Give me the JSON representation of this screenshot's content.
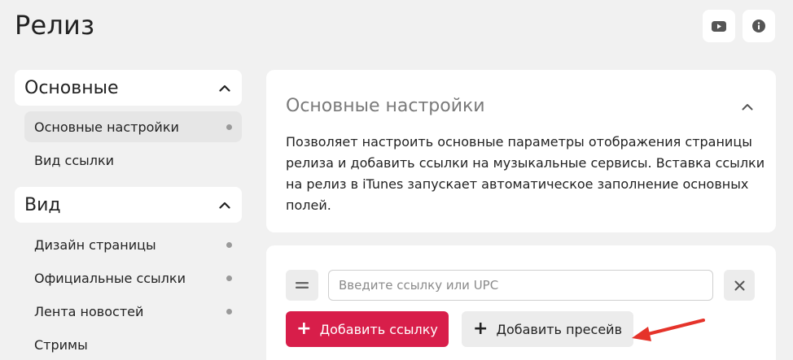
{
  "page": {
    "title": "Релиз"
  },
  "top_actions": {
    "youtube_icon": "youtube-icon",
    "info_icon": "info-icon"
  },
  "sidebar": {
    "sections": [
      {
        "label": "Основные",
        "items": [
          {
            "label": "Основные настройки",
            "active": true,
            "dot": true
          },
          {
            "label": "Вид ссылки",
            "active": false,
            "dot": false
          }
        ]
      },
      {
        "label": "Вид",
        "items": [
          {
            "label": "Дизайн страницы",
            "dot": true
          },
          {
            "label": "Официальные ссылки",
            "dot": true
          },
          {
            "label": "Лента новостей",
            "dot": true
          },
          {
            "label": "Стримы",
            "dot": false
          }
        ]
      }
    ]
  },
  "main": {
    "settings_card": {
      "title": "Основные настройки",
      "description": "Позволяет настроить основные параметры отображения страницы релиза и добавить ссылки на музыкальные сервисы. Вставка ссылки на релиз в iTunes запускает автоматическое заполнение основных полей."
    },
    "links_card": {
      "input_value": "",
      "input_placeholder": "Введите ссылку или UPC",
      "add_link_label": "Добавить ссылку",
      "add_presave_label": "Добавить пресейв"
    }
  },
  "colors": {
    "accent": "#d81e4a",
    "arrow": "#e5332a",
    "background": "#f1f1f1"
  }
}
